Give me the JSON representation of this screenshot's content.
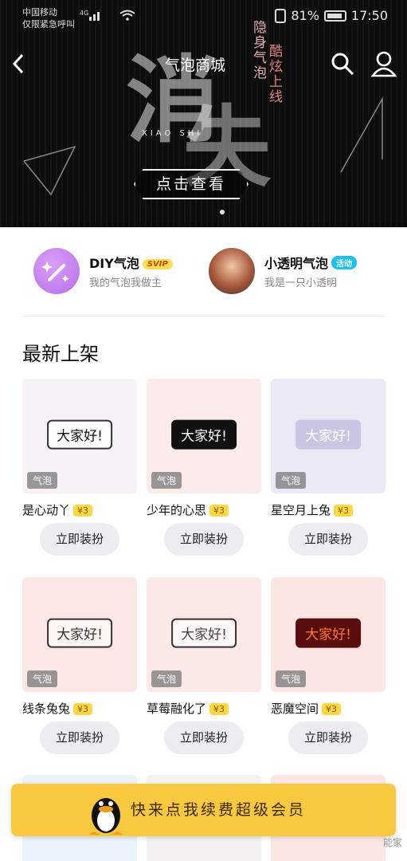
{
  "status": {
    "carrier": "中国移动",
    "emergency": "仅限紧急呼叫",
    "network": "4G",
    "battery": "81%",
    "time": "17:50"
  },
  "nav": {
    "title": "气泡商城"
  },
  "banner": {
    "char1": "消",
    "char2": "失",
    "vertical1": "隐身气泡",
    "vertical2": "酷炫上线",
    "pinyin": "XIAO SHI",
    "cta": "点击查看"
  },
  "features": [
    {
      "title": "DIY气泡",
      "tag": "SVIP",
      "subtitle": "我的气泡我做主"
    },
    {
      "title": "小透明气泡",
      "tag": "活动",
      "subtitle": "我是一只小透明"
    }
  ],
  "section": {
    "title": "最新上架"
  },
  "items": [
    {
      "name": "是心动丫",
      "price": "¥3",
      "badge": "气泡",
      "bubble": "大家好!",
      "button": "立即装扮",
      "bg": "#f7f2f5",
      "bubble_bg": "#ffffff",
      "bubble_fg": "#111111"
    },
    {
      "name": "少年的心思",
      "price": "¥3",
      "badge": "气泡",
      "bubble": "大家好!",
      "button": "立即装扮",
      "bg": "#fbeceb",
      "bubble_bg": "#111111",
      "bubble_fg": "#ffffff"
    },
    {
      "name": "星空月上兔",
      "price": "¥3",
      "badge": "气泡",
      "bubble": "大家好!",
      "button": "立即装扮",
      "bg": "#ebe9f5",
      "bubble_bg": "#c9c6e4",
      "bubble_fg": "#ffffff"
    },
    {
      "name": "线条兔兔",
      "price": "¥3",
      "badge": "气泡",
      "bubble": "大家好!",
      "button": "立即装扮",
      "bg": "#fbe8e6",
      "bubble_bg": "#fff6f4",
      "bubble_fg": "#333333"
    },
    {
      "name": "草莓融化了",
      "price": "¥3",
      "badge": "气泡",
      "bubble": "大家好!",
      "button": "立即装扮",
      "bg": "#fbe9e7",
      "bubble_bg": "#fff8f6",
      "bubble_fg": "#444444"
    },
    {
      "name": "恶魔空间",
      "price": "¥3",
      "badge": "气泡",
      "bubble": "大家好!",
      "button": "立即装扮",
      "bg": "#fbe6e4",
      "bubble_bg": "#5a0d0d",
      "bubble_fg": "#ff7b2c"
    }
  ],
  "promo": {
    "text": "快来点我续费超级会员"
  },
  "watermark": "能家"
}
